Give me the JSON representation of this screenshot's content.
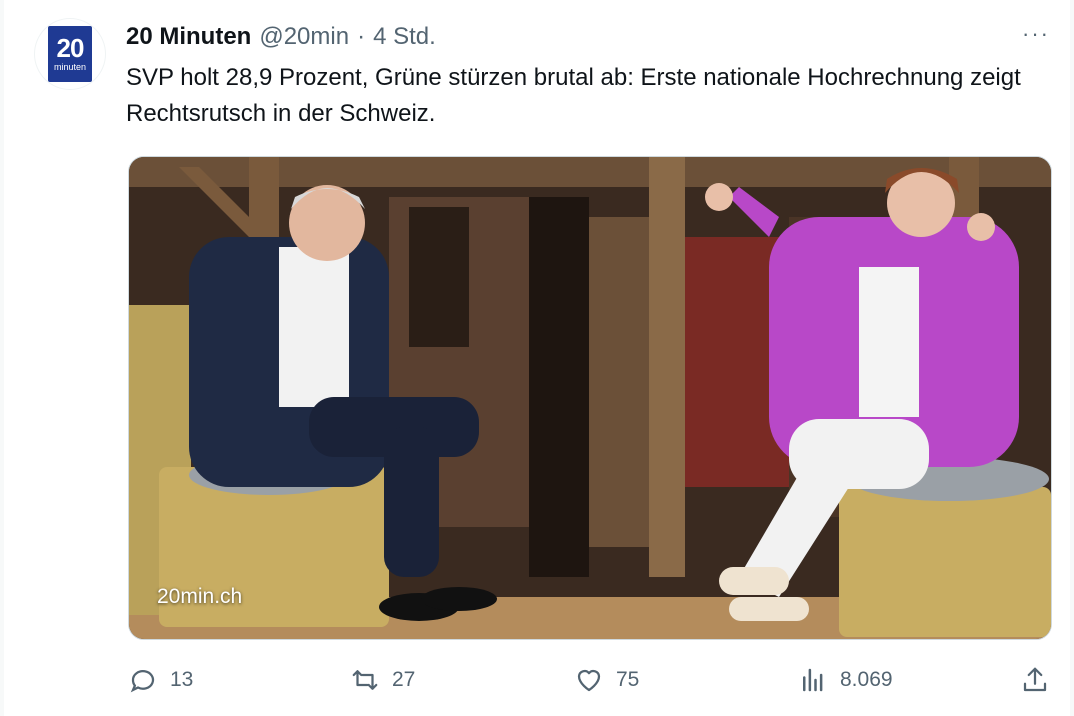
{
  "tweet": {
    "author_name": "20 Minuten",
    "handle": "@20min",
    "separator": "·",
    "time": "4 Std.",
    "text": "SVP holt 28,9 Prozent, Grüne stürzen brutal ab: Erste nationale Hochrechnung zeigt Rechtsrutsch in der Schweiz.",
    "more_label": "···"
  },
  "avatar": {
    "logo_number": "20",
    "logo_word": "minuten",
    "brand_color": "#1f3a93"
  },
  "media": {
    "source_label": "20min.ch"
  },
  "actions": {
    "replies": "13",
    "retweets": "27",
    "likes": "75",
    "views": "8.069",
    "icons": [
      "reply-icon",
      "retweet-icon",
      "like-icon",
      "views-icon",
      "share-icon"
    ]
  },
  "colors": {
    "text": "#0f1419",
    "muted": "#536471",
    "border": "#cfd9de"
  }
}
